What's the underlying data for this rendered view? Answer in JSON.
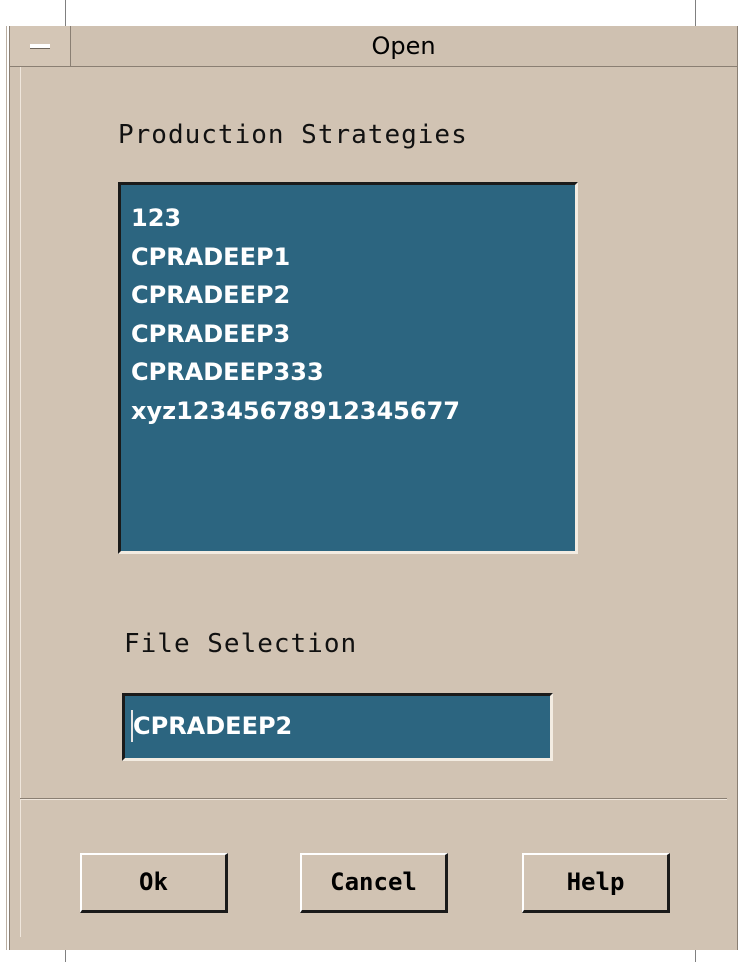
{
  "window": {
    "title": "Open",
    "menu_icon": "window-menu-icon"
  },
  "strategies": {
    "label": "Production Strategies",
    "items": [
      "123",
      "CPRADEEP1",
      "CPRADEEP2",
      "CPRADEEP3",
      "CPRADEEP333",
      "xyz12345678912345677"
    ]
  },
  "file_selection": {
    "label": "File Selection",
    "value": "CPRADEEP2"
  },
  "buttons": {
    "ok": "Ok",
    "cancel": "Cancel",
    "help": "Help"
  },
  "colors": {
    "background": "#d1c3b3",
    "field": "#2c6580"
  }
}
